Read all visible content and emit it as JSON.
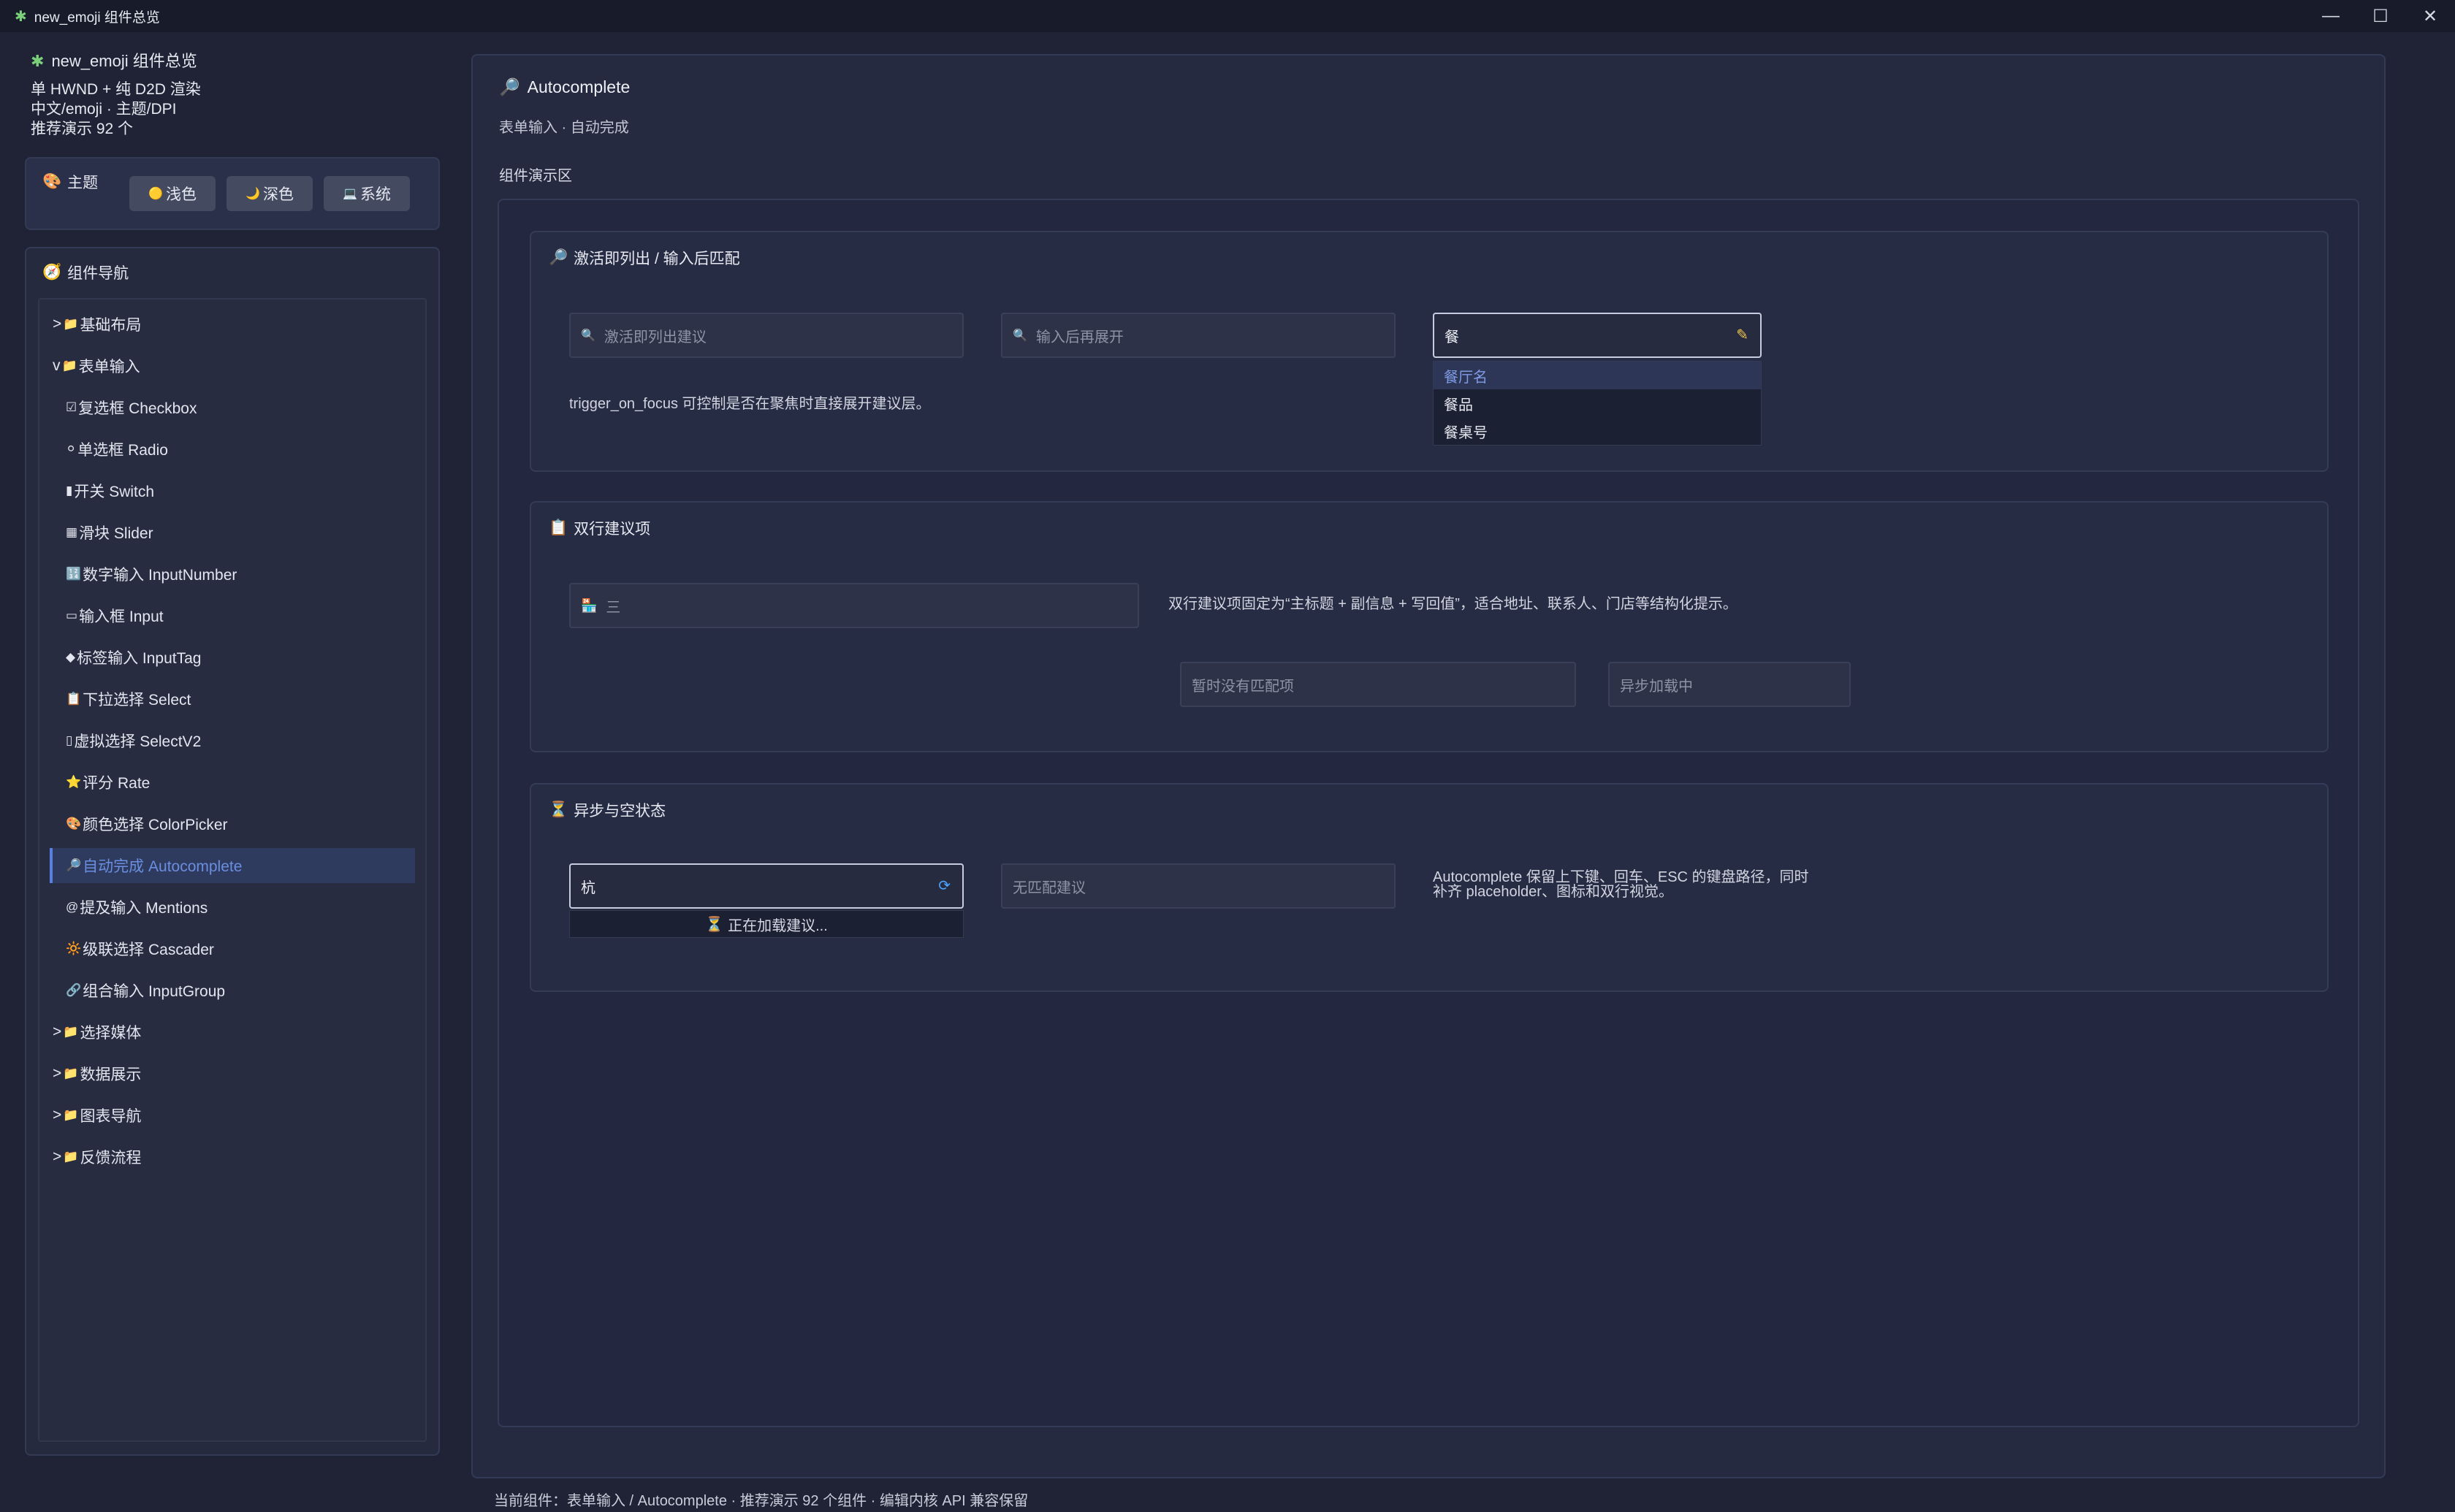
{
  "window": {
    "title": "new_emoji 组件总览",
    "app_icon": "puzzle-icon",
    "controls": {
      "minimize": "—",
      "maximize": "☐",
      "close": "✕"
    }
  },
  "sidebar": {
    "app_name": "new_emoji 组件总览",
    "info_lines": [
      "单 HWND + 纯 D2D 渲染",
      "中文/emoji · 主题/DPI",
      "推荐演示 92 个"
    ],
    "theme": {
      "label": "主题",
      "buttons": [
        {
          "icon": "🟡",
          "label": "浅色"
        },
        {
          "icon": "🌙",
          "label": "深色"
        },
        {
          "icon": "💻",
          "label": "系统"
        }
      ]
    },
    "nav_title": "组件导航",
    "nav_items": [
      {
        "prefix": ">",
        "icon": "📁",
        "label": "基础布局"
      },
      {
        "prefix": "v",
        "icon": "📁",
        "label": "表单输入"
      },
      {
        "prefix": "",
        "icon": "☑",
        "label": "复选框 Checkbox"
      },
      {
        "prefix": "",
        "icon": "⚪",
        "label": "单选框 Radio"
      },
      {
        "prefix": "",
        "icon": "▮",
        "label": "开关 Switch"
      },
      {
        "prefix": "",
        "icon": "▦",
        "label": "滑块 Slider"
      },
      {
        "prefix": "",
        "icon": "🔢",
        "label": "数字输入 InputNumber"
      },
      {
        "prefix": "",
        "icon": "▭",
        "label": "输入框 Input"
      },
      {
        "prefix": "",
        "icon": "◆",
        "label": "标签输入 InputTag"
      },
      {
        "prefix": "",
        "icon": "📋",
        "label": "下拉选择 Select"
      },
      {
        "prefix": "",
        "icon": "▯",
        "label": "虚拟选择 SelectV2"
      },
      {
        "prefix": "",
        "icon": "⭐",
        "label": "评分 Rate"
      },
      {
        "prefix": "",
        "icon": "🎨",
        "label": "颜色选择 ColorPicker"
      },
      {
        "prefix": "",
        "icon": "🔎",
        "label": "自动完成 Autocomplete"
      },
      {
        "prefix": "",
        "icon": "@",
        "label": "提及输入 Mentions"
      },
      {
        "prefix": "",
        "icon": "🔆",
        "label": "级联选择 Cascader"
      },
      {
        "prefix": "",
        "icon": "🔗",
        "label": "组合输入 InputGroup"
      },
      {
        "prefix": ">",
        "icon": "📁",
        "label": "选择媒体"
      },
      {
        "prefix": ">",
        "icon": "📁",
        "label": "数据展示"
      },
      {
        "prefix": ">",
        "icon": "📁",
        "label": "图表导航"
      },
      {
        "prefix": ">",
        "icon": "📁",
        "label": "反馈流程"
      }
    ]
  },
  "main": {
    "title": "Autocomplete",
    "subtitle": "表单输入 · 自动完成",
    "demo_label": "组件演示区",
    "sec1": {
      "title": "激活即列出 / 输入后匹配",
      "input1_placeholder": "激活即列出建议",
      "input2_placeholder": "输入后再展开",
      "input3_value": "餐",
      "options": [
        "餐厅名",
        "餐品",
        "餐桌号"
      ],
      "desc": "trigger_on_focus 可控制是否在聚焦时直接展开建议层。"
    },
    "sec2": {
      "title": "双行建议项",
      "input_value": "三",
      "desc": "双行建议项固定为“主标题 + 副信息 + 写回值”，适合地址、联系人、门店等结构化提示。",
      "field_no_match": "暂时没有匹配项",
      "field_async": "异步加载中"
    },
    "sec3": {
      "title": "异步与空状态",
      "input_value": "杭",
      "loading_text": "正在加载建议...",
      "no_match_placeholder": "无匹配建议",
      "desc_line1": "Autocomplete 保留上下键、回车、ESC 的键盘路径，同时",
      "desc_line2": "补齐 placeholder、图标和双行视觉。"
    }
  },
  "status_bar": "当前组件：表单输入 / Autocomplete · 推荐演示 92 个组件 · 编辑内核 API 兼容保留"
}
